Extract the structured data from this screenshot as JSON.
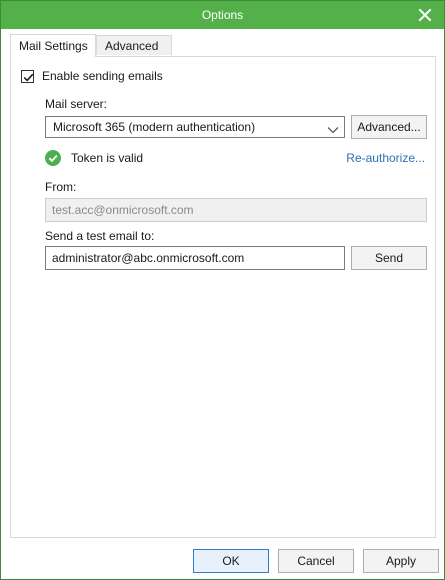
{
  "window": {
    "title": "Options"
  },
  "tabs": [
    {
      "label": "Mail Settings",
      "active": true
    },
    {
      "label": "Advanced",
      "active": false
    }
  ],
  "mail": {
    "enable_label": "Enable sending emails",
    "enable_checked": true,
    "server_label": "Mail server:",
    "server_value": "Microsoft 365 (modern authentication)",
    "advanced_button": "Advanced...",
    "token_status": "Token is valid",
    "reauthorize_link": "Re-authorize...",
    "from_label": "From:",
    "from_value": "test.acc@onmicrosoft.com",
    "test_label": "Send a test email to:",
    "test_value": "administrator@abc.onmicrosoft.com",
    "send_button": "Send"
  },
  "footer": {
    "ok_label": "OK",
    "cancel_label": "Cancel",
    "apply_label": "Apply"
  },
  "colors": {
    "titlebar": "#54b14a",
    "status_ok": "#4caf50",
    "link": "#2a6fb5"
  },
  "icons": {
    "close": "close-icon",
    "checkmark": "checkmark-icon",
    "chevron": "chevron-down-icon",
    "status": "success-check-icon"
  }
}
